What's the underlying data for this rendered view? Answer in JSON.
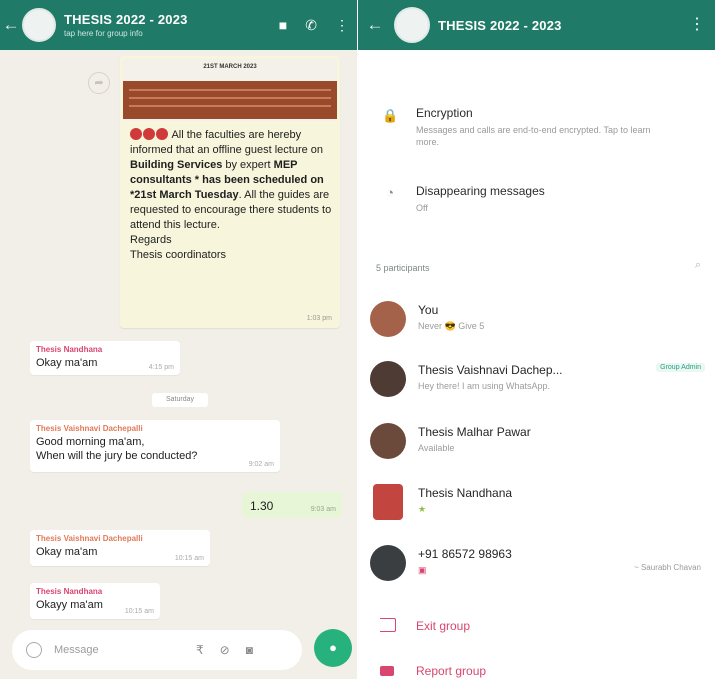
{
  "left_chat": {
    "title": "THESIS 2022 - 2023",
    "subtitle": "tap here for group info",
    "image_message": {
      "doc_title": "21ST MARCH 2023",
      "text_parts": {
        "p1": "All the faculties are hereby informed that an offline guest lecture on ",
        "b1": "Building Services",
        "p2": " by expert ",
        "b2": "MEP consultants * has been scheduled on *21st March Tuesday",
        "p3": ". All the guides are requested to encourage there students to attend this lecture.",
        "p4": "Regards",
        "p5": "Thesis coordinators"
      },
      "time": "1:03 pm"
    },
    "messages": [
      {
        "sender": "Thesis Nandhana",
        "text": "Okay ma'am",
        "time": "4:15 pm"
      },
      {
        "sender": "Thesis Vaishnavi Dachepalli",
        "text_line1": "Good morning ma'am,",
        "text_line2": "When will the jury be conducted?",
        "time": "9:02 am"
      },
      {
        "sender": "Thesis Vaishnavi Dachepalli",
        "text": "Okay ma'am",
        "time": "10:15 am"
      },
      {
        "sender": "Thesis Nandhana",
        "text": "Okayy ma'am",
        "time": "10:15 am"
      }
    ],
    "day_divider": "Saturday",
    "outgoing": {
      "text": "1.30",
      "time": "9:03 am"
    },
    "input_placeholder": "Message"
  },
  "right_info": {
    "title": "THESIS 2022 - 2023",
    "encryption": {
      "title": "Encryption",
      "subtitle": "Messages and calls are end-to-end encrypted. Tap to learn more."
    },
    "disappearing": {
      "title": "Disappearing messages",
      "subtitle": "Off"
    },
    "participants_label": "5 participants",
    "members": [
      {
        "name": "You",
        "status": "Never 😎 Give 5"
      },
      {
        "name": "Thesis Vaishnavi Dachep...",
        "status": "Hey there! I am using WhatsApp.",
        "badge": "Group Admin"
      },
      {
        "name": "Thesis Malhar Pawar",
        "status": "Available"
      },
      {
        "name": "Thesis Nandhana",
        "status": "★"
      },
      {
        "name": "+91 86572 98963",
        "status": "",
        "extra": "~ Saurabh Chavan"
      }
    ],
    "exit_label": "Exit group",
    "report_label": "Report group"
  },
  "colors": {
    "header_green": "#1f7a68",
    "accent_pink": "#d9466f",
    "mic_green": "#27b27d"
  }
}
